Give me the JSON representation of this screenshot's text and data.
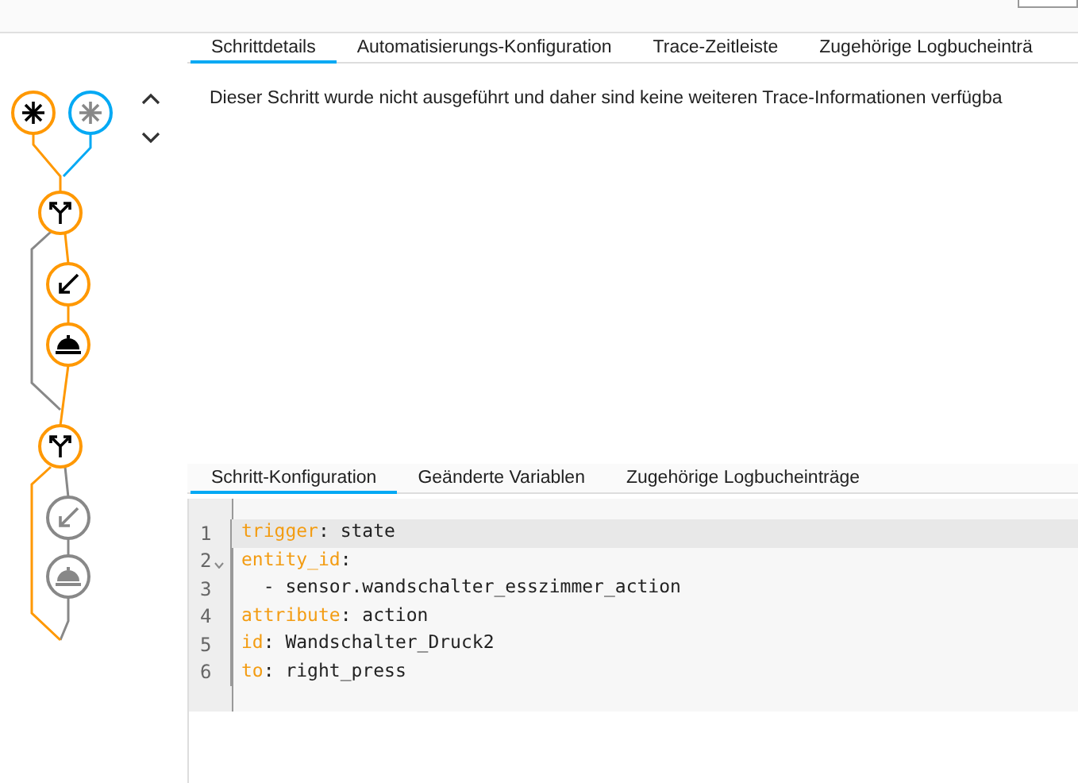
{
  "graph": {
    "nodes": [
      {
        "kind": "trigger",
        "executed": true,
        "selected": false
      },
      {
        "kind": "trigger",
        "executed": false,
        "selected": true
      },
      {
        "kind": "choose",
        "executed": true,
        "selected": false
      },
      {
        "kind": "call",
        "executed": true,
        "selected": false
      },
      {
        "kind": "event",
        "executed": true,
        "selected": false
      },
      {
        "kind": "choose",
        "executed": true,
        "selected": false
      },
      {
        "kind": "call",
        "executed": false,
        "selected": false
      },
      {
        "kind": "event",
        "executed": false,
        "selected": false
      }
    ]
  },
  "top_tabs": [
    {
      "label": "Schrittdetails",
      "selected": true
    },
    {
      "label": "Automatisierungs-Konfiguration",
      "selected": false
    },
    {
      "label": "Trace-Zeitleiste",
      "selected": false
    },
    {
      "label": "Zugehörige Logbucheinträ",
      "selected": false
    }
  ],
  "message": "Dieser Schritt wurde nicht ausgeführt und daher sind keine weiteren Trace-Informationen verfügba",
  "bottom_tabs": [
    {
      "label": "Schritt-Konfiguration",
      "selected": true
    },
    {
      "label": "Geänderte Variablen",
      "selected": false
    },
    {
      "label": "Zugehörige Logbucheinträge",
      "selected": false
    }
  ],
  "code": {
    "lines": [
      {
        "number": "1",
        "key": "trigger",
        "text": ": state",
        "fold": false,
        "highlighted": true
      },
      {
        "number": "2",
        "key": "entity_id",
        "text": ":",
        "fold": true,
        "highlighted": false
      },
      {
        "number": "3",
        "text": "  - sensor.wandschalter_esszimmer_action",
        "fold": false,
        "highlighted": false
      },
      {
        "number": "4",
        "key": "attribute",
        "text": ": action",
        "fold": false,
        "highlighted": false
      },
      {
        "number": "5",
        "key": "id",
        "text": ": Wandschalter_Druck2",
        "fold": false,
        "highlighted": false
      },
      {
        "number": "6",
        "key": "to",
        "text": ": right_press",
        "fold": false,
        "highlighted": false
      }
    ]
  }
}
